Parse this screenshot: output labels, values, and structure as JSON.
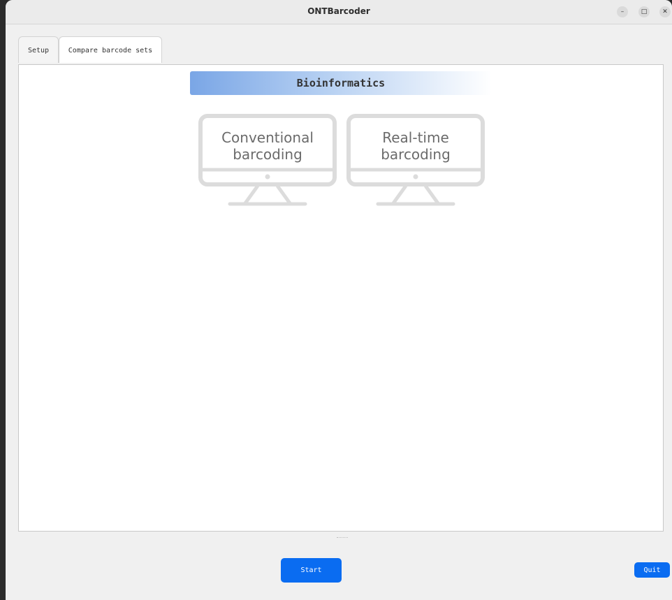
{
  "window": {
    "title": "ONTBarcoder",
    "controls": {
      "minimize": "–",
      "maximize": "□",
      "close": "✕"
    }
  },
  "tabs": [
    {
      "label": "Setup",
      "active": false
    },
    {
      "label": "Compare barcode sets",
      "active": true
    }
  ],
  "main": {
    "banner_title": "Bioinformatics",
    "options": [
      {
        "label": "Conventional\nbarcoding",
        "icon": "monitor-icon"
      },
      {
        "label": "Real-time\nbarcoding",
        "icon": "monitor-icon"
      }
    ]
  },
  "footer": {
    "start_label": "Start",
    "quit_label": "Quit"
  },
  "colors": {
    "accent": "#0a6cf1",
    "banner_gradient_start": "#7aa6e6",
    "monitor_stroke": "#dcdcdc",
    "monitor_text": "#6b6b6b"
  }
}
